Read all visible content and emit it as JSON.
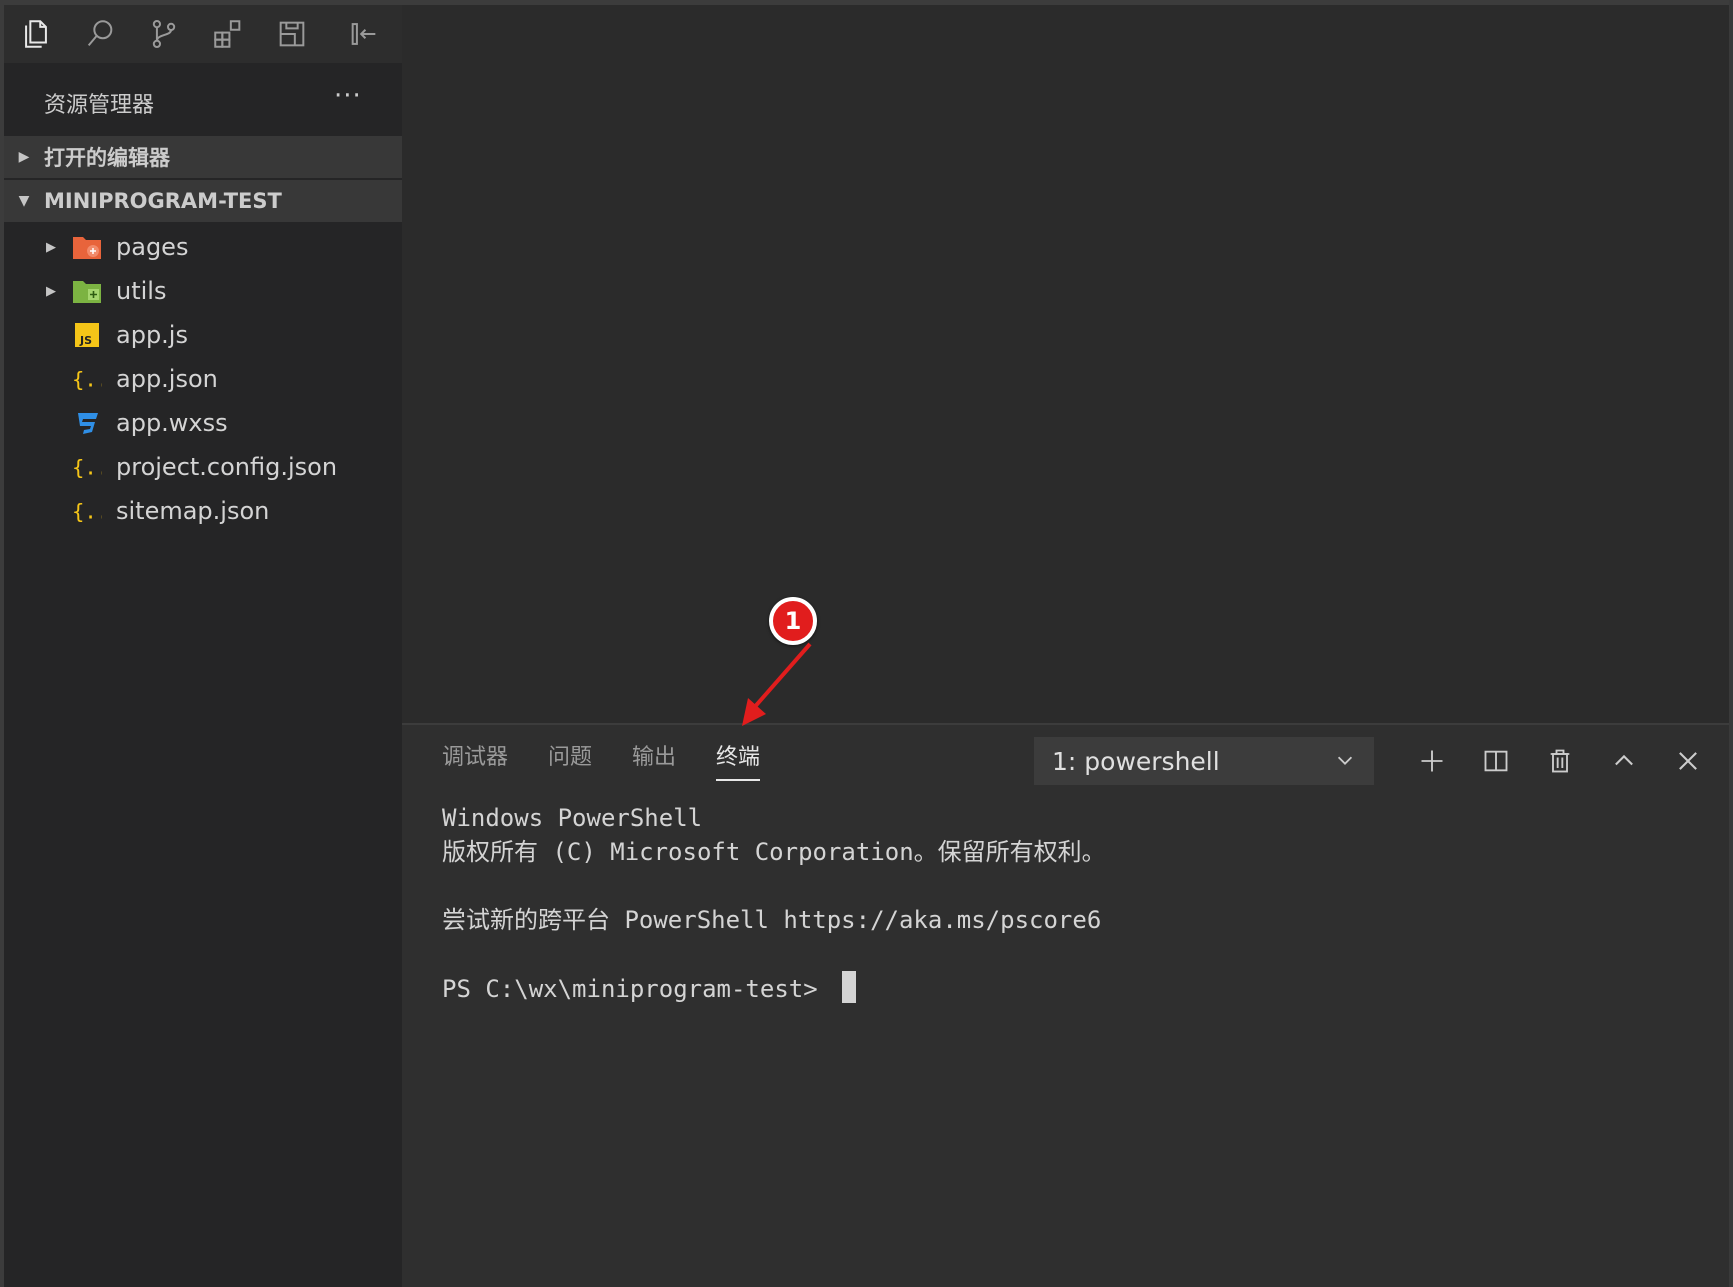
{
  "activity_bar": {
    "icons": [
      "files-icon",
      "search-icon",
      "source-control-icon",
      "extensions-icon",
      "layout-icon",
      "collapse-sidebar-icon"
    ]
  },
  "explorer": {
    "title": "资源管理器",
    "more": "···",
    "open_editors_label": "打开的编辑器",
    "project_label": "MINIPROGRAM-TEST",
    "tree": [
      {
        "name": "pages",
        "type": "folder",
        "color": "#e8643b"
      },
      {
        "name": "utils",
        "type": "folder",
        "color": "#7cb342"
      },
      {
        "name": "app.js",
        "type": "js",
        "color": "#f5c518"
      },
      {
        "name": "app.json",
        "type": "json",
        "color": "#f5c518"
      },
      {
        "name": "app.wxss",
        "type": "css",
        "color": "#2f8fe6"
      },
      {
        "name": "project.config.json",
        "type": "json",
        "color": "#f5c518"
      },
      {
        "name": "sitemap.json",
        "type": "json",
        "color": "#f5c518"
      }
    ]
  },
  "annotation": {
    "badge_number": "1",
    "color": "#e11d1d"
  },
  "panel": {
    "tabs": [
      {
        "label": "调试器",
        "active": false
      },
      {
        "label": "问题",
        "active": false
      },
      {
        "label": "输出",
        "active": false
      },
      {
        "label": "终端",
        "active": true
      }
    ],
    "terminal_select": "1: powershell",
    "actions": [
      "plus-icon",
      "split-icon",
      "trash-icon",
      "chevron-up-icon",
      "close-icon"
    ]
  },
  "terminal": {
    "line1": "Windows PowerShell",
    "line2": "版权所有 (C) Microsoft Corporation。保留所有权利。",
    "line3": "尝试新的跨平台 PowerShell https://aka.ms/pscore6",
    "prompt": "PS C:\\wx\\miniprogram-test> "
  }
}
